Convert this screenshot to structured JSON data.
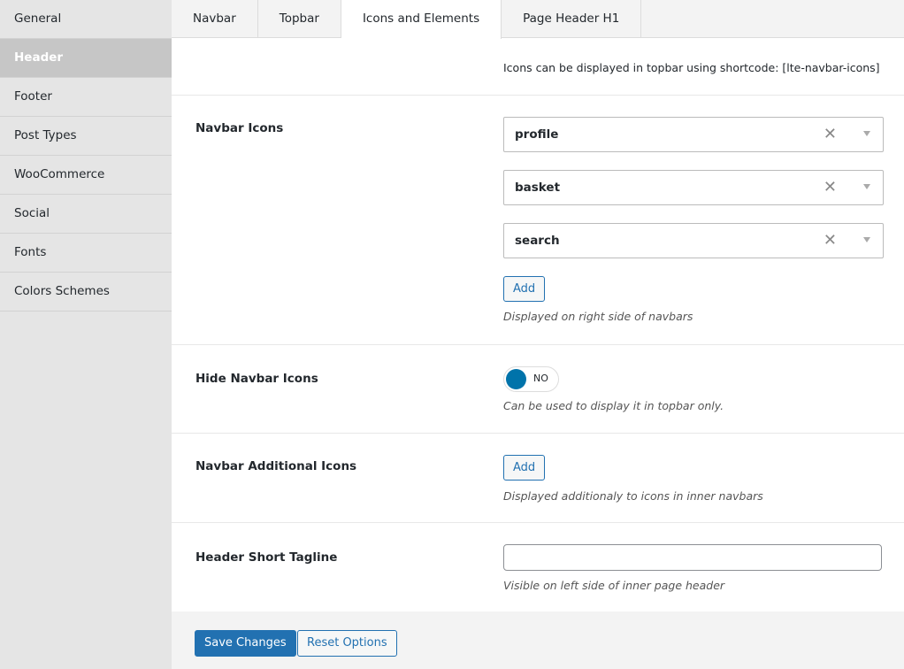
{
  "sidebar": {
    "items": [
      {
        "label": "General"
      },
      {
        "label": "Header"
      },
      {
        "label": "Footer"
      },
      {
        "label": "Post Types"
      },
      {
        "label": "WooCommerce"
      },
      {
        "label": "Social"
      },
      {
        "label": "Fonts"
      },
      {
        "label": "Colors Schemes"
      }
    ]
  },
  "tabs": [
    {
      "label": "Navbar"
    },
    {
      "label": "Topbar"
    },
    {
      "label": "Icons and Elements"
    },
    {
      "label": "Page Header H1"
    }
  ],
  "notice": "Icons can be displayed in topbar using shortcode: [lte-navbar-icons]",
  "navbar_icons": {
    "label": "Navbar Icons",
    "items": [
      {
        "value": "profile"
      },
      {
        "value": "basket"
      },
      {
        "value": "search"
      }
    ],
    "clear_glyph": "✕",
    "add_label": "Add",
    "desc": "Displayed on right side of navbars"
  },
  "hide_navbar_icons": {
    "label": "Hide Navbar Icons",
    "toggle_state": "NO",
    "desc": "Can be used to display it in topbar only."
  },
  "additional_icons": {
    "label": "Navbar Additional Icons",
    "add_label": "Add",
    "desc": "Displayed additionaly to icons in inner navbars"
  },
  "tagline": {
    "label": "Header Short Tagline",
    "value": "",
    "desc": "Visible on left side of inner page header"
  },
  "footer": {
    "save_label": "Save Changes",
    "reset_label": "Reset Options"
  },
  "colors": {
    "accent": "#2271b1",
    "toggle": "#0073aa"
  }
}
